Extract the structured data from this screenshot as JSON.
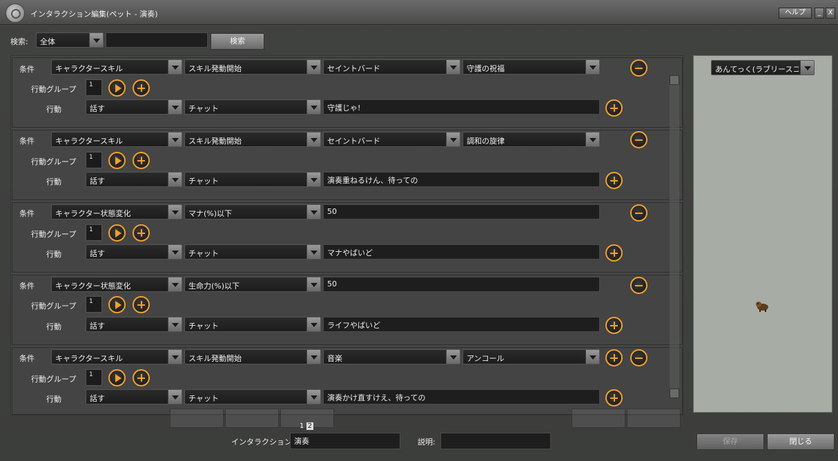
{
  "window": {
    "title": "インタラクション編集(ペット - 演奏)",
    "help_label": "ヘルプ",
    "minimize_label": "_",
    "close_label": "X"
  },
  "search": {
    "label": "検索:",
    "scope_value": "全体",
    "query_value": "",
    "button_label": "検索"
  },
  "rules": [
    {
      "condition_label": "条件",
      "condition": [
        "キャラクタースキル",
        "スキル発動開始",
        "セイントバード",
        "守護の祝福"
      ],
      "group_label": "行動グループ",
      "group_value": "1",
      "action_label": "行動",
      "action_type": "話す",
      "action_channel": "チャット",
      "action_text": "守護じゃ!"
    },
    {
      "condition_label": "条件",
      "condition": [
        "キャラクタースキル",
        "スキル発動開始",
        "セイントバード",
        "調和の旋律"
      ],
      "group_label": "行動グループ",
      "group_value": "1",
      "action_label": "行動",
      "action_type": "話す",
      "action_channel": "チャット",
      "action_text": "演奏重ねるけん、待っての"
    },
    {
      "condition_label": "条件",
      "condition": [
        "キャラクター状態変化",
        "マナ(%)以下",
        "50"
      ],
      "group_label": "行動グループ",
      "group_value": "1",
      "action_label": "行動",
      "action_type": "話す",
      "action_channel": "チャット",
      "action_text": "マナやばいど"
    },
    {
      "condition_label": "条件",
      "condition": [
        "キャラクター状態変化",
        "生命力(%)以下",
        "50"
      ],
      "group_label": "行動グループ",
      "group_value": "1",
      "action_label": "行動",
      "action_type": "話す",
      "action_channel": "チャット",
      "action_text": "ライフやばいど"
    },
    {
      "condition_label": "条件",
      "condition": [
        "キャラクタースキル",
        "スキル発動開始",
        "音楽",
        "アンコール"
      ],
      "group_label": "行動グループ",
      "group_value": "1",
      "action_label": "行動",
      "action_type": "話す",
      "action_channel": "チャット",
      "action_text": "演奏かけ直すけえ、待っての"
    }
  ],
  "pet_selector": {
    "value": "あんてっく(ラブリースコティッ"
  },
  "pagination": {
    "pages": [
      "1",
      "2"
    ],
    "current": "2"
  },
  "footer": {
    "name_label": "インタラクション名:",
    "name_value": "演奏",
    "desc_label": "説明:",
    "desc_value": "",
    "save_label": "保存",
    "close_label": "閉じる"
  }
}
